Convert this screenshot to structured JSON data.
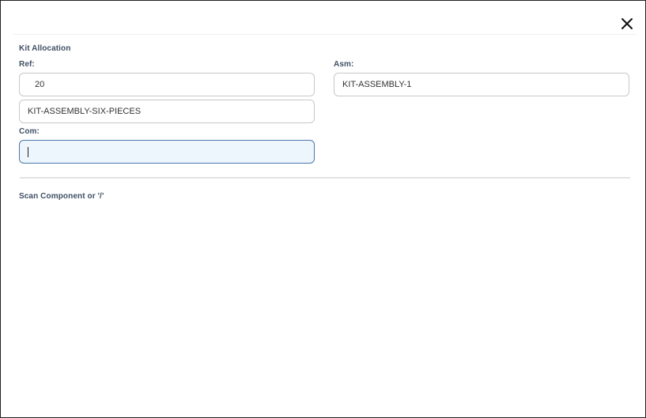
{
  "dialog": {
    "close_icon": "close-icon",
    "section_title": "Kit Allocation"
  },
  "form": {
    "ref_label": "Ref:",
    "ref_value": "20",
    "kit_name_value": "KIT-ASSEMBLY-SIX-PIECES",
    "asm_label": "Asm:",
    "asm_value": "KIT-ASSEMBLY-1",
    "com_label": "Com:",
    "com_value": ""
  },
  "scan": {
    "prompt": "Scan Component or '/'"
  },
  "colors": {
    "label_text": "#3f4f63",
    "active_field_border": "#4a78a8",
    "active_field_bg": "#eef6fd"
  }
}
